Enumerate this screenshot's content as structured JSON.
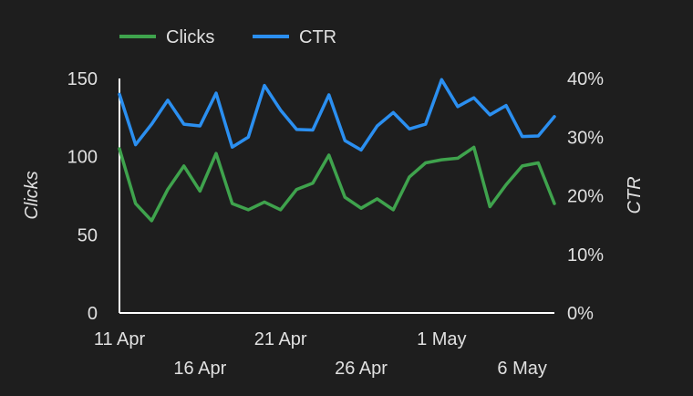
{
  "chart_data": {
    "type": "line",
    "x": [
      "11 Apr",
      "12 Apr",
      "13 Apr",
      "14 Apr",
      "15 Apr",
      "16 Apr",
      "17 Apr",
      "18 Apr",
      "19 Apr",
      "20 Apr",
      "21 Apr",
      "22 Apr",
      "23 Apr",
      "24 Apr",
      "25 Apr",
      "26 Apr",
      "27 Apr",
      "28 Apr",
      "29 Apr",
      "30 Apr",
      "1 May",
      "2 May",
      "3 May",
      "4 May",
      "5 May",
      "6 May",
      "7 May",
      "8 May"
    ],
    "x_ticks": [
      "11 Apr",
      "16 Apr",
      "21 Apr",
      "26 Apr",
      "1 May",
      "6 May"
    ],
    "series": [
      {
        "name": "Clicks",
        "axis": "left",
        "color": "#3fa34d",
        "values": [
          105,
          70,
          59,
          79,
          94,
          78,
          102,
          70,
          66,
          71,
          66,
          79,
          83,
          101,
          74,
          67,
          73,
          66,
          87,
          96,
          98,
          99,
          106,
          68,
          82,
          94,
          96,
          70
        ]
      },
      {
        "name": "CTR",
        "axis": "right",
        "color": "#2b8ff0",
        "values": [
          0.373,
          0.287,
          0.322,
          0.363,
          0.322,
          0.319,
          0.375,
          0.283,
          0.3,
          0.388,
          0.346,
          0.313,
          0.312,
          0.372,
          0.294,
          0.278,
          0.319,
          0.342,
          0.314,
          0.322,
          0.398,
          0.352,
          0.367,
          0.338,
          0.354,
          0.301,
          0.302,
          0.335
        ]
      }
    ],
    "y_left": {
      "label": "Clicks",
      "ticks": [
        "0",
        "50",
        "100",
        "150"
      ],
      "range": [
        0,
        150
      ]
    },
    "y_right": {
      "label": "CTR",
      "ticks": [
        "0%",
        "10%",
        "20%",
        "30%",
        "40%"
      ],
      "range": [
        0,
        0.4
      ]
    },
    "legend": {
      "position": "top-left",
      "items": [
        "Clicks",
        "CTR"
      ]
    },
    "grid": false
  }
}
